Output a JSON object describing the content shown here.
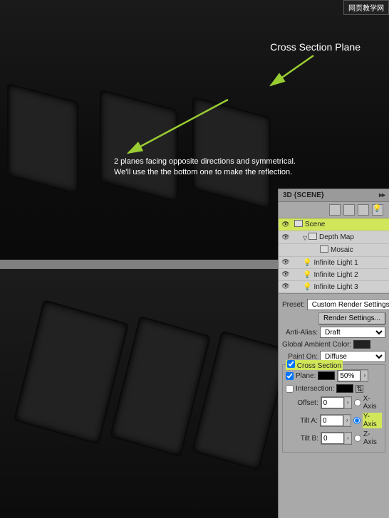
{
  "watermark": "网页教学网",
  "annotation": {
    "title": "Cross Section Plane",
    "line1": "2 planes facing opposite directions and symmetrical.",
    "line2": "We'll use the the bottom one to make the reflection."
  },
  "panel": {
    "tab": "3D {SCENE}"
  },
  "tree": {
    "scene": "Scene",
    "depthMap": "Depth Map",
    "mosaic": "Mosaic",
    "light1": "Infinite Light 1",
    "light2": "Infinite Light 2",
    "light3": "Infinite Light 3"
  },
  "settings": {
    "presetLabel": "Preset:",
    "presetValue": "Custom Render Settings",
    "renderBtn": "Render Settings...",
    "aaLabel": "Anti-Alias:",
    "aaValue": "Draft",
    "ambientLabel": "Global Ambient Color:",
    "paintLabel": "Paint On:",
    "paintValue": "Diffuse"
  },
  "crossSection": {
    "legend": "Cross Section",
    "plane": "Plane:",
    "planePct": "50%",
    "intersection": "Intersection:",
    "offsetLabel": "Offset:",
    "offsetVal": "0",
    "tiltALabel": "Tilt A:",
    "tiltAVal": "0",
    "tiltBLabel": "Tilt B:",
    "tiltBVal": "0",
    "xAxis": "X-Axis",
    "yAxis": "Y-Axis",
    "zAxis": "Z-Axis"
  }
}
